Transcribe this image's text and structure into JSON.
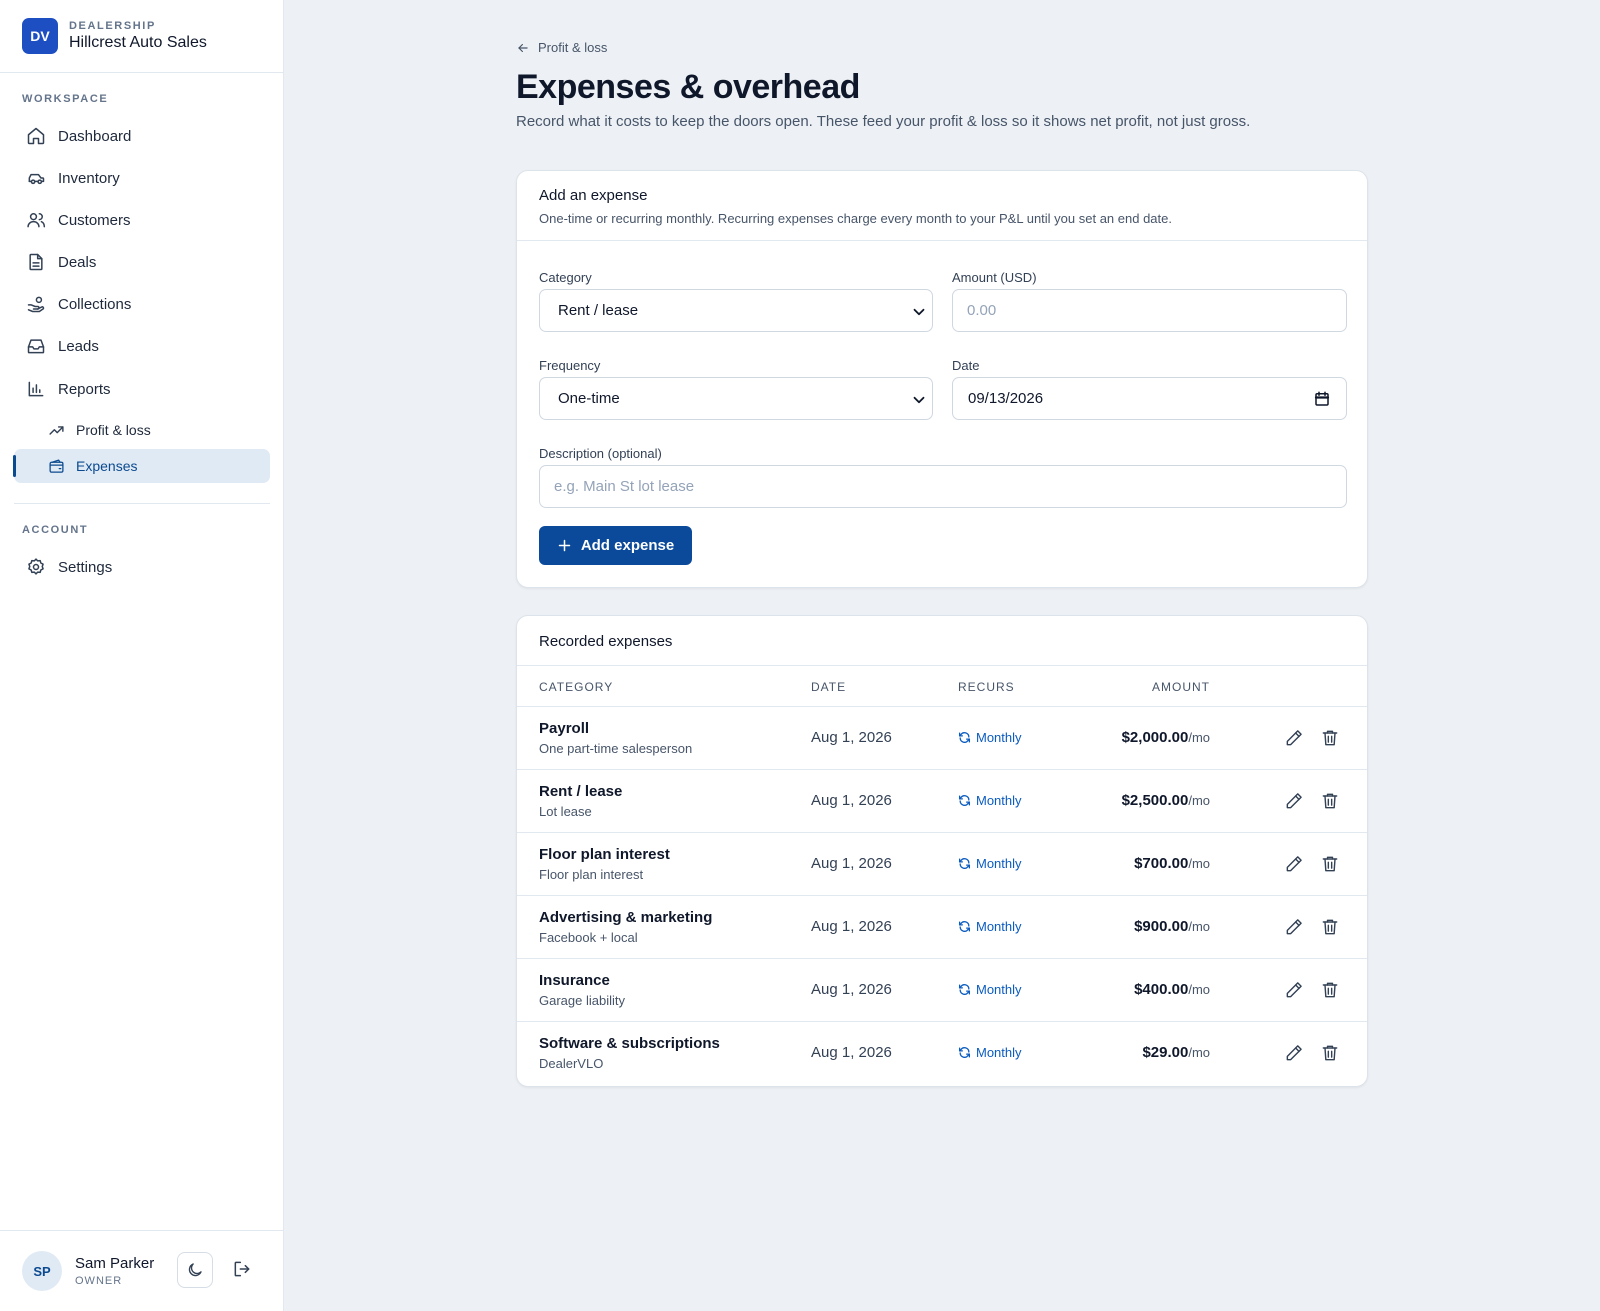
{
  "brand": {
    "initials": "DV",
    "eyebrow": "DEALERSHIP",
    "name": "Hillcrest Auto Sales"
  },
  "sidebar": {
    "workspace_label": "WORKSPACE",
    "account_label": "ACCOUNT",
    "items": [
      {
        "label": "Dashboard",
        "icon": "home-icon"
      },
      {
        "label": "Inventory",
        "icon": "car-icon"
      },
      {
        "label": "Customers",
        "icon": "users-icon"
      },
      {
        "label": "Deals",
        "icon": "document-icon"
      },
      {
        "label": "Collections",
        "icon": "hand-coins-icon"
      },
      {
        "label": "Leads",
        "icon": "inbox-icon"
      },
      {
        "label": "Reports",
        "icon": "bar-chart-icon"
      },
      {
        "label": "Profit & loss",
        "icon": "trending-up-icon"
      },
      {
        "label": "Expenses",
        "icon": "wallet-icon",
        "active": true
      }
    ],
    "settings_label": "Settings"
  },
  "user": {
    "initials": "SP",
    "name": "Sam Parker",
    "role": "OWNER"
  },
  "breadcrumb": {
    "back_label": "Profit & loss"
  },
  "page": {
    "title": "Expenses & overhead",
    "subtitle": "Record what it costs to keep the doors open. These feed your profit & loss so it shows net profit, not just gross."
  },
  "form": {
    "title": "Add an expense",
    "description": "One-time or recurring monthly. Recurring expenses charge every month to your P&L until you set an end date.",
    "category_label": "Category",
    "category_value": "Rent / lease",
    "amount_label": "Amount (USD)",
    "amount_placeholder": "0.00",
    "frequency_label": "Frequency",
    "frequency_value": "One-time",
    "date_label": "Date",
    "date_value": "09/13/2026",
    "description_label": "Description (optional)",
    "description_placeholder": "e.g. Main St lot lease",
    "submit_label": "Add expense"
  },
  "table": {
    "title": "Recorded expenses",
    "columns": {
      "category": "CATEGORY",
      "date": "DATE",
      "recurs": "RECURS",
      "amount": "AMOUNT"
    },
    "rows": [
      {
        "category": "Payroll",
        "description": "One part-time salesperson",
        "date": "Aug 1, 2026",
        "recurs": "Monthly",
        "amount": "$2,000.00",
        "per": "/mo"
      },
      {
        "category": "Rent / lease",
        "description": "Lot lease",
        "date": "Aug 1, 2026",
        "recurs": "Monthly",
        "amount": "$2,500.00",
        "per": "/mo"
      },
      {
        "category": "Floor plan interest",
        "description": "Floor plan interest",
        "date": "Aug 1, 2026",
        "recurs": "Monthly",
        "amount": "$700.00",
        "per": "/mo"
      },
      {
        "category": "Advertising & marketing",
        "description": "Facebook + local",
        "date": "Aug 1, 2026",
        "recurs": "Monthly",
        "amount": "$900.00",
        "per": "/mo"
      },
      {
        "category": "Insurance",
        "description": "Garage liability",
        "date": "Aug 1, 2026",
        "recurs": "Monthly",
        "amount": "$400.00",
        "per": "/mo"
      },
      {
        "category": "Software & subscriptions",
        "description": "DealerVLO",
        "date": "Aug 1, 2026",
        "recurs": "Monthly",
        "amount": "$29.00",
        "per": "/mo"
      }
    ]
  },
  "colors": {
    "primary": "#0b4a9b",
    "brand": "#1e4fc2",
    "active_bg": "#e0eaf5",
    "recur_link": "#0b5cc0",
    "page_bg": "#edf1f5"
  }
}
